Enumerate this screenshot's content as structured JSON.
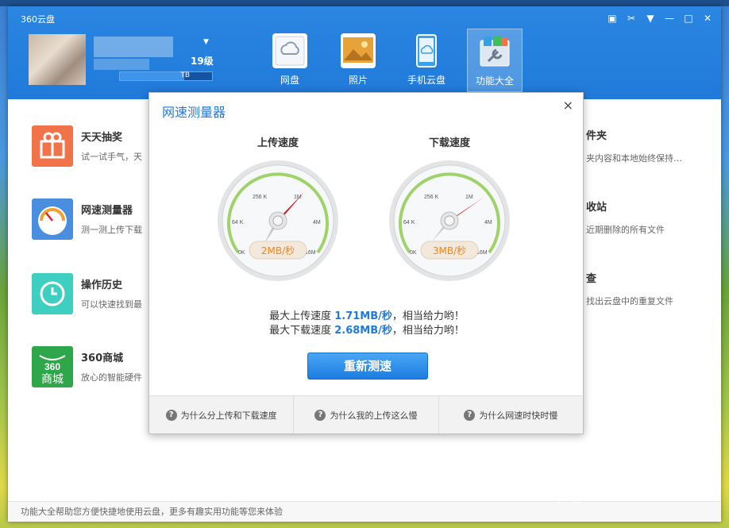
{
  "window": {
    "title": "360云盘",
    "controls": [
      "feedback-icon",
      "skin-icon",
      "menu-icon",
      "minimize-icon",
      "maximize-icon",
      "close-icon"
    ]
  },
  "user": {
    "level": "19级",
    "quota_text": "TB"
  },
  "nav": {
    "items": [
      {
        "label": "网盘",
        "icon": "cloud-drive-icon"
      },
      {
        "label": "照片",
        "icon": "photos-icon"
      },
      {
        "label": "手机云盘",
        "icon": "mobile-cloud-icon"
      },
      {
        "label": "功能大全",
        "icon": "tools-icon"
      }
    ],
    "active": "功能大全"
  },
  "features_left": [
    {
      "title": "天天抽奖",
      "desc": "试一试手气，天",
      "color": "#f0734a"
    },
    {
      "title": "网速测量器",
      "desc": "测一测上传下载",
      "color": "#4a8ee0"
    },
    {
      "title": "操作历史",
      "desc": "可以快速找到最",
      "color": "#3fcfc1"
    },
    {
      "title": "360商城",
      "desc": "放心的智能硬件",
      "color": "#2ea64a"
    }
  ],
  "features_right": [
    {
      "title": "件夹",
      "desc": "夹内容和本地始终保持…"
    },
    {
      "title": "收站",
      "desc": "近期删除的所有文件"
    },
    {
      "title": "查",
      "desc": "找出云盘中的重复文件"
    }
  ],
  "statusbar": "功能大全帮助您方便快捷地使用云盘，更多有趣实用功能等您来体验",
  "dialog": {
    "title": "网速测量器",
    "close": "×",
    "upload_label": "上传速度",
    "download_label": "下载速度",
    "gauge_ticks": [
      "0K",
      "64 K",
      "256 K",
      "1M",
      "4M",
      "16M"
    ],
    "upload_readout": "2MB/秒",
    "download_readout": "3MB/秒",
    "result_up_prefix": "最大上传速度 ",
    "result_up_value": "1.71MB/秒",
    "result_up_suffix": "，相当给力哟！",
    "result_down_prefix": "最大下载速度 ",
    "result_down_value": "2.68MB/秒",
    "result_down_suffix": "，相当给力哟！",
    "retest": "重新测速",
    "faqs": [
      "为什么分上传和下载速度",
      "为什么我的上传这么慢",
      "为什么网速时快时慢"
    ]
  },
  "watermark": {
    "main": "Baidu经验",
    "sub": "jingyan.baidu.com"
  },
  "colors": {
    "accent": "#1f7ad9",
    "needle": "#d9232a",
    "readout": "#f0861a"
  }
}
